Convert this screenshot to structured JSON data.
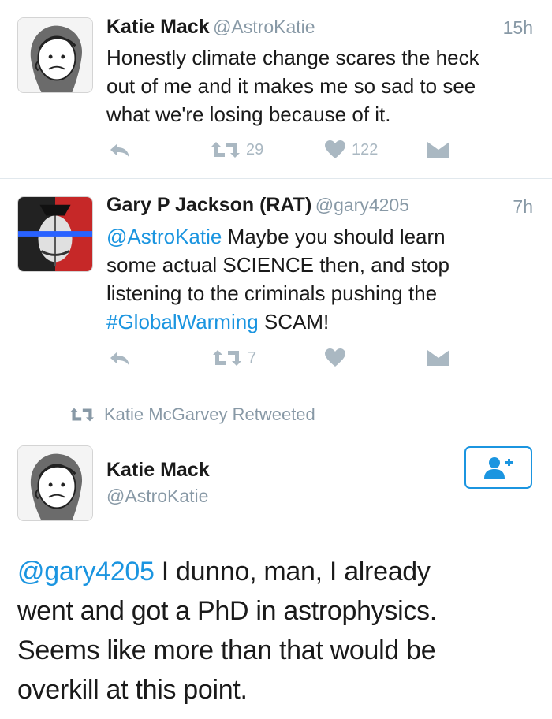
{
  "tweet1": {
    "name": "Katie Mack",
    "handle": "@AstroKatie",
    "time": "15h",
    "text": "Honestly climate change scares the heck out of me and it makes me so sad to see what we're losing because of it.",
    "line1": "Honestly climate change scares the heck",
    "line2": "out of me and it makes me so sad to see",
    "line3": "what we're losing because of it.",
    "retweets": "29",
    "likes": "122"
  },
  "tweet2": {
    "name": "Gary P Jackson (RAT)",
    "handle": "@gary4205",
    "time": "7h",
    "mention": "@AstroKatie",
    "line1_rest": " Maybe you should learn",
    "line2": "some actual SCIENCE then, and stop",
    "line3": "listening to the criminals pushing the",
    "hashtag": "#GlobalWarming",
    "line4_rest": " SCAM!",
    "retweets": "7"
  },
  "retweet_banner": {
    "text": "Katie McGarvey Retweeted"
  },
  "tweet3": {
    "name": "Katie Mack",
    "handle": "@AstroKatie",
    "mention": "@gary4205",
    "line1_rest": " I dunno, man, I already",
    "line2": "went and got a PhD in astrophysics.",
    "line3": "Seems like more than that would be",
    "line4": "overkill at this point."
  },
  "icons": {
    "reply": "reply-icon",
    "retweet": "retweet-icon",
    "like": "heart-icon",
    "dm": "envelope-icon",
    "follow": "follow-user-icon"
  },
  "colors": {
    "link": "#1b95e0",
    "muted": "#8899a6",
    "icon": "#aab8c2"
  }
}
